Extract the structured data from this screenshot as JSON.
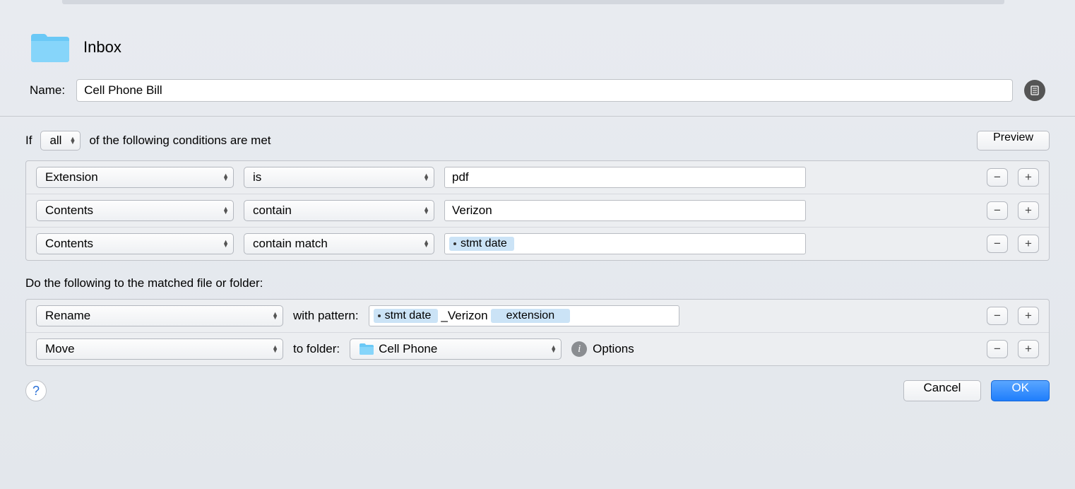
{
  "header": {
    "folder_name": "Inbox",
    "name_label": "Name:",
    "name_value": "Cell Phone Bill"
  },
  "conditions": {
    "if_prefix": "If",
    "match_mode": "all",
    "if_suffix": "of the following conditions are met",
    "preview_label": "Preview",
    "rows": [
      {
        "attribute": "Extension",
        "operator": "is",
        "value_type": "text",
        "value": "pdf"
      },
      {
        "attribute": "Contents",
        "operator": "contain",
        "value_type": "text",
        "value": "Verizon"
      },
      {
        "attribute": "Contents",
        "operator": "contain match",
        "value_type": "token",
        "tokens": [
          {
            "kind": "var",
            "label": "stmt date"
          }
        ]
      }
    ]
  },
  "actions": {
    "heading": "Do the following to the matched file or folder:",
    "rows": [
      {
        "action": "Rename",
        "mid_label": "with pattern:",
        "pattern_tokens": [
          {
            "kind": "var",
            "label": "stmt date"
          },
          {
            "kind": "text",
            "label": "_Verizon"
          },
          {
            "kind": "var_plain",
            "label": "extension"
          }
        ]
      },
      {
        "action": "Move",
        "mid_label": "to folder:",
        "folder": "Cell Phone",
        "options_label": "Options"
      }
    ]
  },
  "footer": {
    "help": "?",
    "cancel": "Cancel",
    "ok": "OK"
  }
}
